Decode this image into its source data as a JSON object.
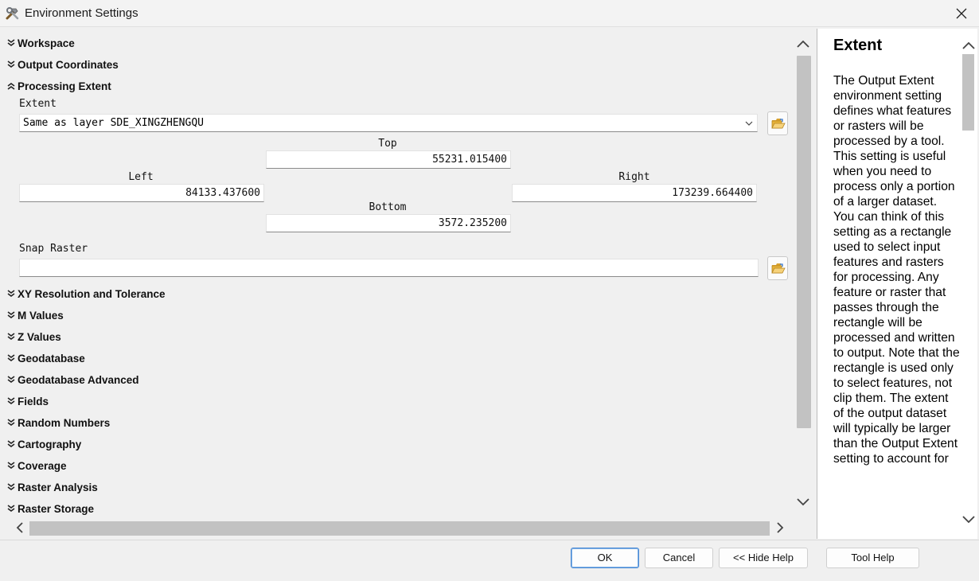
{
  "window": {
    "title": "Environment Settings",
    "icon": "tools-icon"
  },
  "sections_top": [
    {
      "label": "Workspace",
      "expanded": false
    },
    {
      "label": "Output Coordinates",
      "expanded": false
    },
    {
      "label": "Processing Extent",
      "expanded": true
    }
  ],
  "extent": {
    "label": "Extent",
    "selected_value": "Same as layer SDE_XINGZHENGQU",
    "top_label": "Top",
    "top_value": "55231.015400",
    "left_label": "Left",
    "left_value": "84133.437600",
    "right_label": "Right",
    "right_value": "173239.664400",
    "bottom_label": "Bottom",
    "bottom_value": "3572.235200"
  },
  "snap_raster": {
    "label": "Snap Raster",
    "value": ""
  },
  "sections_bottom": [
    {
      "label": "XY Resolution and Tolerance",
      "expanded": false
    },
    {
      "label": "M Values",
      "expanded": false
    },
    {
      "label": "Z Values",
      "expanded": false
    },
    {
      "label": "Geodatabase",
      "expanded": false
    },
    {
      "label": "Geodatabase Advanced",
      "expanded": false
    },
    {
      "label": "Fields",
      "expanded": false
    },
    {
      "label": "Random Numbers",
      "expanded": false
    },
    {
      "label": "Cartography",
      "expanded": false
    },
    {
      "label": "Coverage",
      "expanded": false
    },
    {
      "label": "Raster Analysis",
      "expanded": false
    },
    {
      "label": "Raster Storage",
      "expanded": false
    }
  ],
  "help": {
    "title": "Extent",
    "body": "The Output Extent environment setting defines what features or rasters will be processed by a tool. This setting is useful when you need to process only a portion of a larger dataset. You can think of this setting as a rectangle used to select input features and rasters for processing. Any feature or raster that passes through the rectangle will be processed and written to output. Note that the rectangle is used only to select features, not clip them. The extent of the output dataset will typically be larger than the Output Extent setting to account for"
  },
  "buttons": {
    "ok": "OK",
    "cancel": "Cancel",
    "hide_help": "<< Hide Help",
    "tool_help": "Tool Help"
  },
  "colors": {
    "default_button_border": "#4a8ad4",
    "folder_yellow": "#e8b43a",
    "scrollbar_thumb": "#c2c2c2"
  }
}
